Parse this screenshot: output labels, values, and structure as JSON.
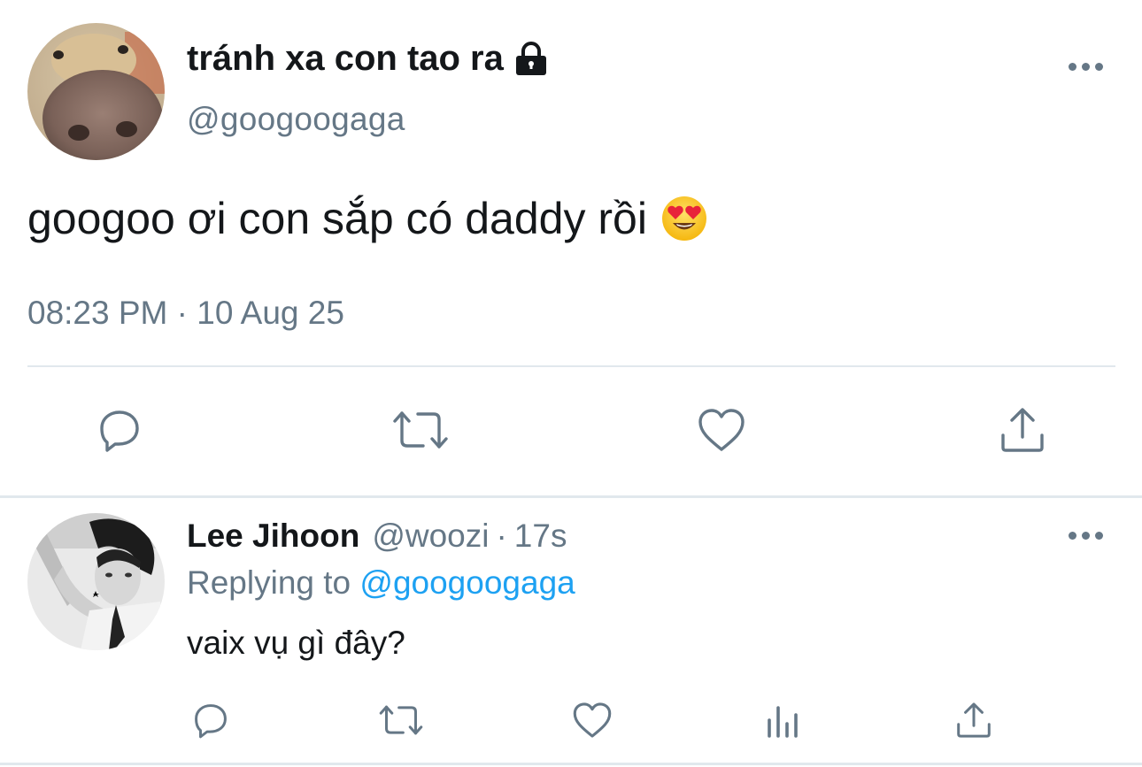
{
  "tweet": {
    "display_name": "tránh xa con tao ra",
    "handle": "@googoogaga",
    "text": "googoo ơi con sắp có daddy rồi",
    "emoji": "smiling-face-with-heart-eyes",
    "timestamp": "08:23 PM · 10 Aug 25",
    "protected": true
  },
  "reply": {
    "display_name": "Lee Jihoon",
    "handle": "@woozi",
    "separator": "·",
    "time": "17s",
    "replying_prefix": "Replying to",
    "replying_to": "@googoogaga",
    "text": "vaix vụ gì đây?"
  },
  "icons": {
    "reply": "reply-icon",
    "retweet": "retweet-icon",
    "like": "heart-icon",
    "share": "share-icon",
    "analytics": "analytics-icon",
    "more": "more-icon"
  },
  "colors": {
    "text": "#14171a",
    "muted": "#657786",
    "link": "#1da1f2",
    "divider": "#e1e8ed"
  }
}
